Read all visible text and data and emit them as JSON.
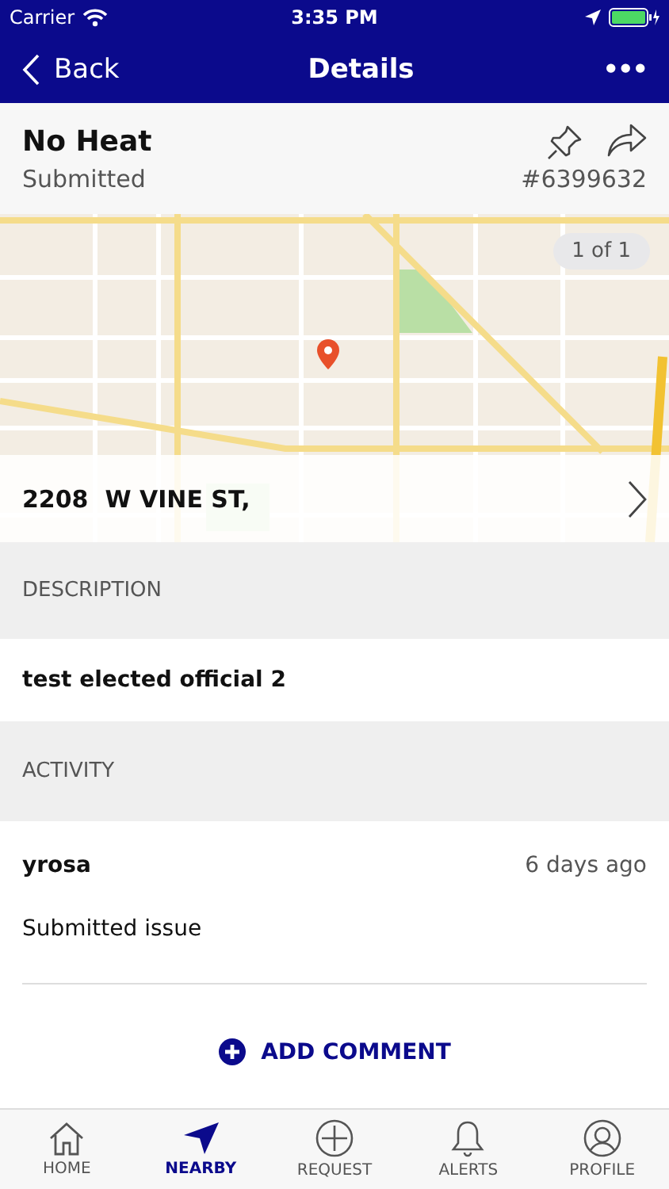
{
  "status_bar": {
    "carrier": "Carrier",
    "time": "3:35 PM"
  },
  "nav": {
    "back": "Back",
    "title": "Details",
    "more": "•••"
  },
  "issue": {
    "title": "No Heat",
    "status": "Submitted",
    "number": "#6399632"
  },
  "map": {
    "counter": "1 of 1",
    "address": "2208  W VINE ST,"
  },
  "description": {
    "heading": "DESCRIPTION",
    "text": "test elected official 2"
  },
  "activity": {
    "heading": "ACTIVITY",
    "entries": [
      {
        "user": "yrosa",
        "time": "6 days ago",
        "text": "Submitted issue"
      }
    ],
    "add_comment": "ADD COMMENT"
  },
  "tabs": [
    {
      "label": "HOME",
      "selected": false
    },
    {
      "label": "NEARBY",
      "selected": true
    },
    {
      "label": "REQUEST",
      "selected": false
    },
    {
      "label": "ALERTS",
      "selected": false
    },
    {
      "label": "PROFILE",
      "selected": false
    }
  ]
}
